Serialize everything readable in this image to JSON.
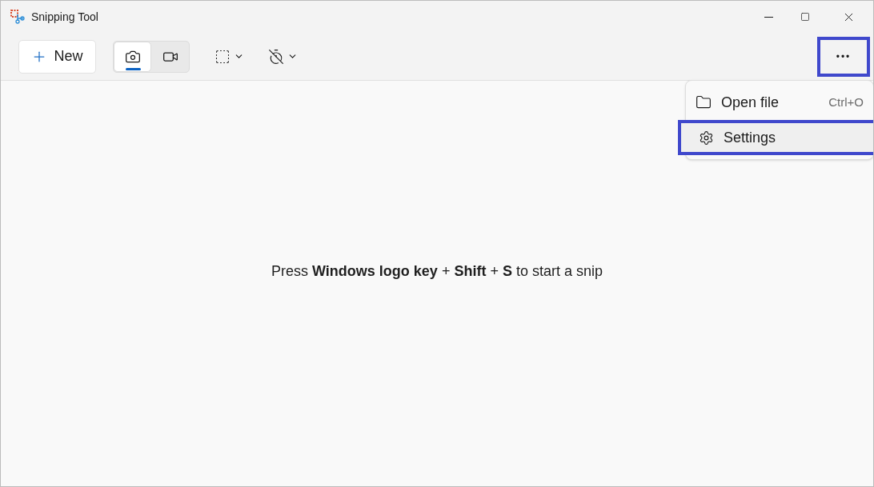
{
  "window": {
    "title": "Snipping Tool"
  },
  "toolbar": {
    "new_button": "New",
    "modes": [
      {
        "kind": "photo",
        "selected": true
      },
      {
        "kind": "video",
        "selected": false
      }
    ],
    "more_button": {
      "label": "•••",
      "highlighted": true
    }
  },
  "menu": [
    {
      "kind": "folder",
      "label": "Open file",
      "shortcut": "Ctrl+O",
      "highlighted": false
    },
    {
      "kind": "gear",
      "label": "Settings",
      "highlighted": true
    }
  ],
  "hint": "Press **Windows logo key** + **Shift** + **S** to start a snip"
}
